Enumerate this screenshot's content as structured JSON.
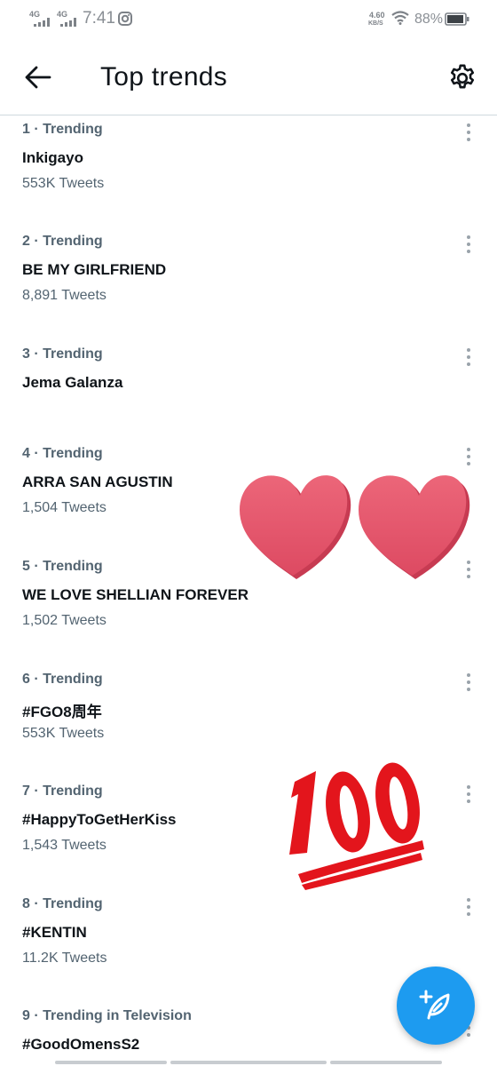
{
  "status_bar": {
    "network_1": "4G",
    "network_2": "4G",
    "time": "7:41",
    "speed_value": "4.60",
    "speed_unit": "KB/S",
    "battery": "88%"
  },
  "header": {
    "title": "Top trends",
    "back_icon": "arrow-left-icon",
    "settings_icon": "gear-icon"
  },
  "trends": [
    {
      "meta": "1 · Trending",
      "name": "Inkigayo",
      "count": "553K Tweets"
    },
    {
      "meta": "2 · Trending",
      "name": "BE MY GIRLFRIEND",
      "count": "8,891 Tweets"
    },
    {
      "meta": "3 · Trending",
      "name": "Jema Galanza",
      "count": ""
    },
    {
      "meta": "4 · Trending",
      "name": "ARRA SAN AGUSTIN",
      "count": "1,504 Tweets"
    },
    {
      "meta": "5 · Trending",
      "name": "WE LOVE SHELLIAN FOREVER",
      "count": "1,502 Tweets"
    },
    {
      "meta": "6 · Trending",
      "name": "#FGO8周年",
      "count": "553K Tweets"
    },
    {
      "meta": "7 · Trending",
      "name": "#HappyToGetHerKiss",
      "count": "1,543 Tweets"
    },
    {
      "meta": "8 · Trending",
      "name": "#KENTIN",
      "count": "11.2K Tweets"
    },
    {
      "meta": "9 · Trending in Television",
      "name": "#GoodOmensS2",
      "count": ""
    }
  ],
  "stickers": {
    "hearts": "two-hearts-sticker",
    "hundred": "hundred-points-sticker"
  },
  "fab": {
    "icon": "compose-tweet-icon",
    "color": "#1d9bf0"
  },
  "colors": {
    "accent": "#1d9bf0",
    "secondary_text": "#536471",
    "heart": "#e8596f",
    "hundred": "#e3151c"
  }
}
